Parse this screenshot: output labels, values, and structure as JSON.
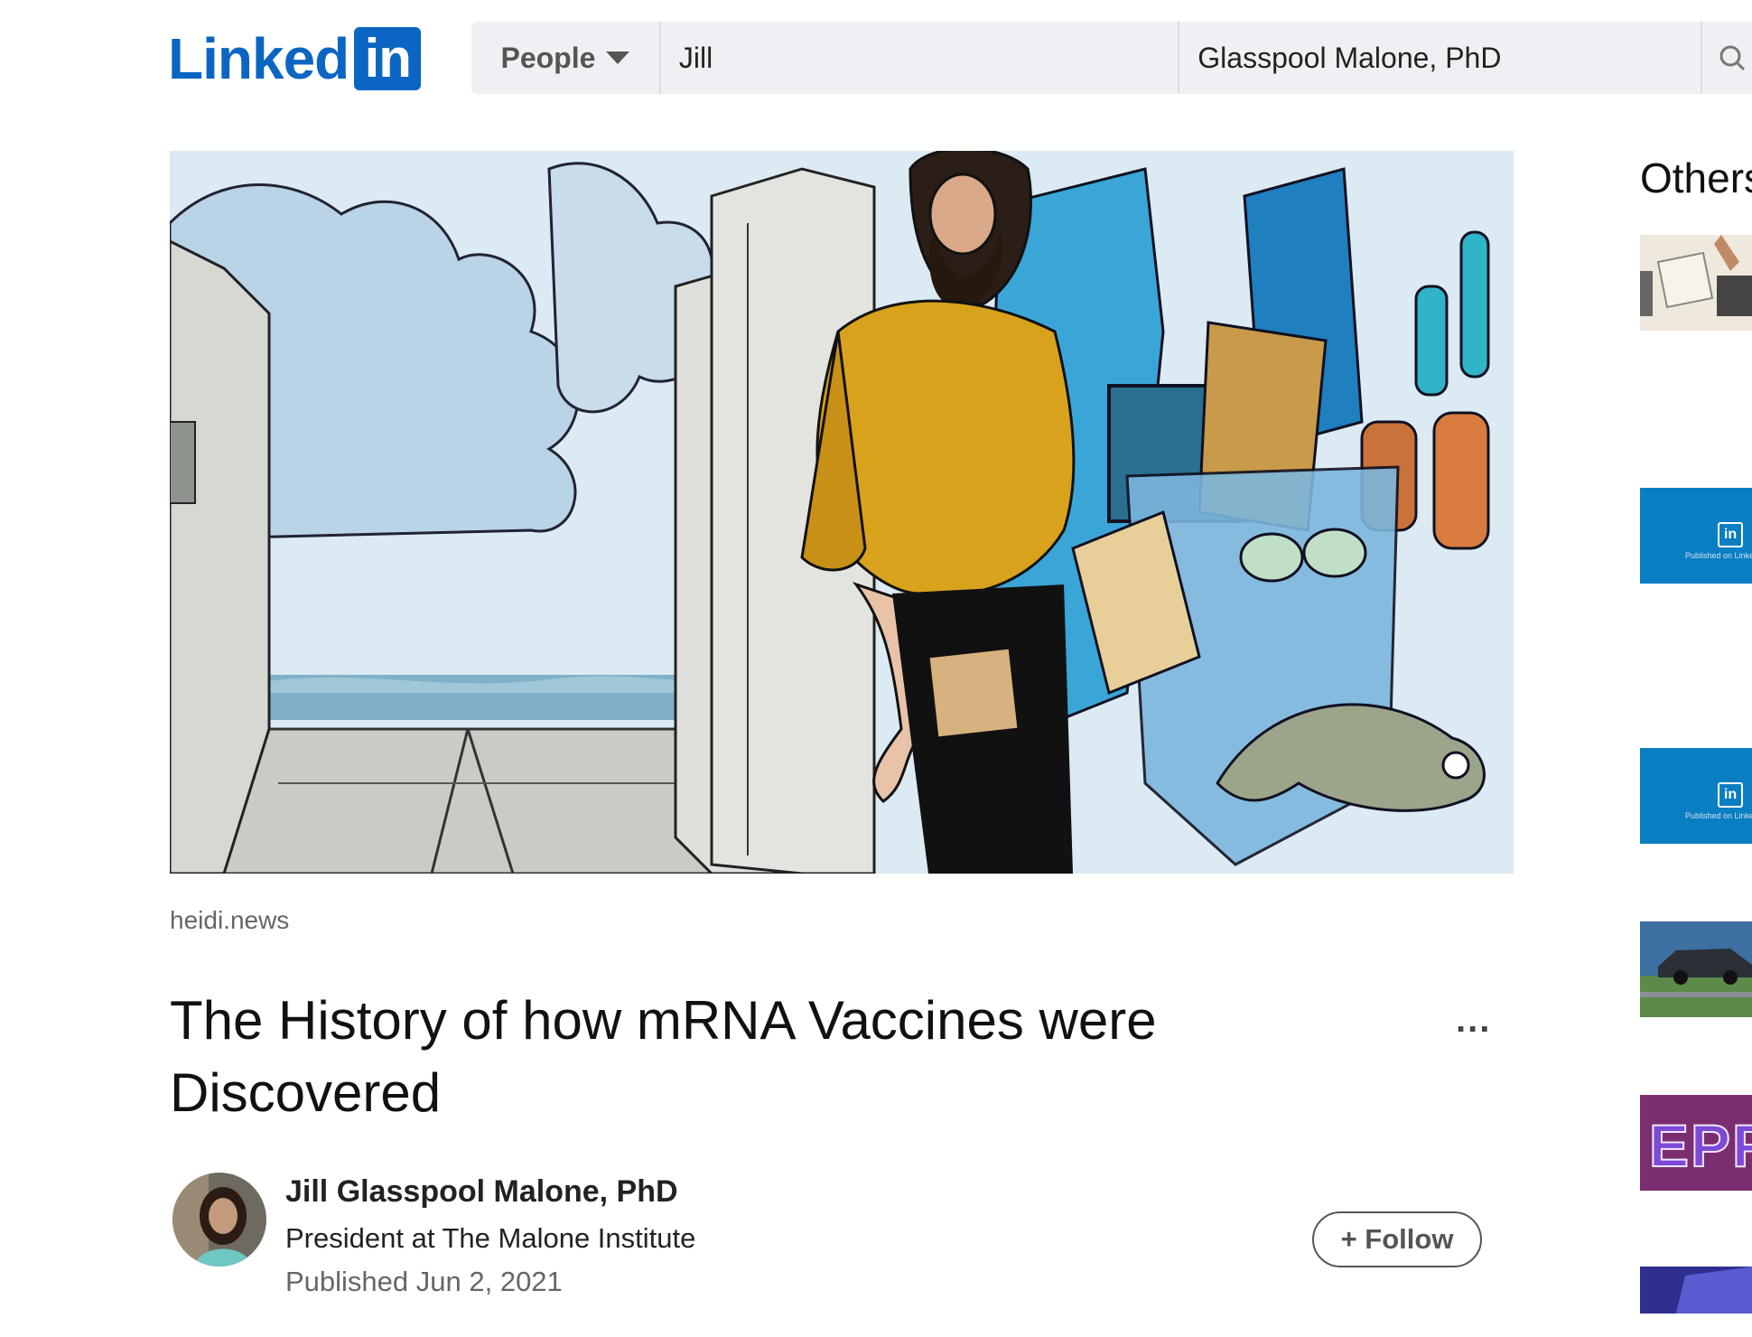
{
  "header": {
    "logo_word": "Linked",
    "logo_box": "in",
    "search": {
      "type_select": "People",
      "first_name": "Jill",
      "last_name": "Glasspool Malone, PhD"
    }
  },
  "article": {
    "image_source": "heidi.news",
    "title": "The History of how mRNA Vaccines were Discovered",
    "more_label": "...",
    "author": {
      "name": "Jill Glasspool Malone, PhD",
      "headline": "President at The Malone Institute",
      "published": "Published Jun 2, 2021"
    },
    "follow_label": "+ Follow"
  },
  "sidebar": {
    "title": "Others",
    "linkedin_thumb_caption": "Published on LinkedIn",
    "linkedin_thumb_logo": "in",
    "thumb_text": "EPF"
  },
  "colors": {
    "brand": "#0a66c2",
    "rail_blue": "#0a7ec2"
  }
}
